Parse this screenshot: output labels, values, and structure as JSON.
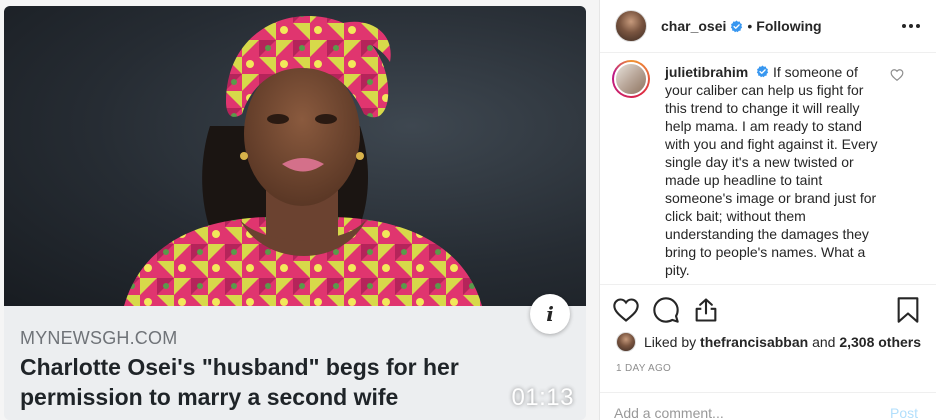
{
  "media": {
    "source": "MYNEWSGH.COM",
    "headline": "Charlotte Osei's \"husband\" begs for her permission to marry a second wife",
    "duration": "01:13",
    "info_icon": "info-icon"
  },
  "header": {
    "username": "char_osei",
    "separator": "•",
    "following": "Following"
  },
  "comment": {
    "username": "julietibrahim",
    "text": " If someone of your caliber can help us fight for this trend to change it will really help mama. I am ready to stand with you and fight against it. Every single day it's a new twisted or made up headline to taint someone's image or brand just for click bait; without them understanding the damages they bring to people's names. What a pity."
  },
  "likes": {
    "prefix": "Liked by",
    "user": "thefrancisabban",
    "and": "and",
    "count": "2,308 others"
  },
  "timestamp": "1 DAY AGO",
  "add_comment": {
    "placeholder": "Add a comment...",
    "post": "Post"
  },
  "colors": {
    "verified": "#3897f0",
    "post_disabled": "#b2dffc",
    "text": "#262626",
    "muted": "#8e8e8e"
  }
}
